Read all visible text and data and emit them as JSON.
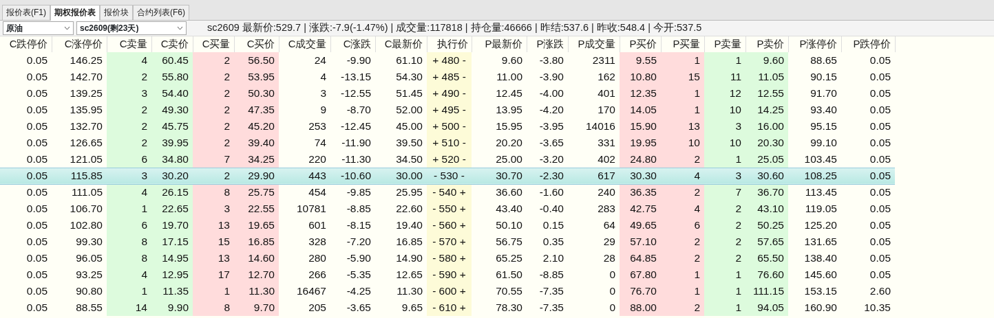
{
  "tabs": [
    {
      "label": "报价表(F1)",
      "selected": false
    },
    {
      "label": "期权报价表",
      "selected": true
    },
    {
      "label": "报价块",
      "selected": false
    },
    {
      "label": "合约列表(F6)",
      "selected": false
    }
  ],
  "selectors": [
    {
      "value": "原油"
    },
    {
      "value": "sc2609(剩23天)"
    }
  ],
  "info_line": "sc2609 最新价:529.7 | 涨跌:-7.9(-1.47%) | 成交量:117818 | 持仓量:46666 | 昨结:537.6 | 昨收:548.4 | 今开:537.5",
  "table": {
    "columns": [
      {
        "label": "C跌停价"
      },
      {
        "label": "C涨停价"
      },
      {
        "label": "C卖量",
        "color": "#ddfbdd"
      },
      {
        "label": "C卖价",
        "color": "#ddfbdd"
      },
      {
        "label": "C买量",
        "color": "#ffdcdc"
      },
      {
        "label": "C买价",
        "color": "#ffdcdc"
      },
      {
        "label": "C成交量"
      },
      {
        "label": "C涨跌"
      },
      {
        "label": "C最新价"
      },
      {
        "label": "执行价",
        "color": "#fdfbd8"
      },
      {
        "label": "P最新价"
      },
      {
        "label": "P涨跌"
      },
      {
        "label": "P成交量"
      },
      {
        "label": "P买价",
        "color": "#ffdcdc"
      },
      {
        "label": "P买量",
        "color": "#ffdcdc"
      },
      {
        "label": "P卖量",
        "color": "#ddfbdd"
      },
      {
        "label": "P卖价",
        "color": "#ddfbdd"
      },
      {
        "label": "P涨停价"
      },
      {
        "label": "P跌停价"
      }
    ],
    "rows": [
      {
        "selected": false,
        "cells": [
          "0.05",
          "146.25",
          "4",
          "60.45",
          "2",
          "56.50",
          "24",
          "-9.90",
          "61.10",
          "+ 480 -",
          "9.60",
          "-3.80",
          "2311",
          "9.55",
          "1",
          "1",
          "9.60",
          "88.65",
          "0.05"
        ]
      },
      {
        "selected": false,
        "cells": [
          "0.05",
          "142.70",
          "2",
          "55.80",
          "2",
          "53.95",
          "4",
          "-13.15",
          "54.30",
          "+ 485 -",
          "11.00",
          "-3.90",
          "162",
          "10.80",
          "15",
          "11",
          "11.05",
          "90.15",
          "0.05"
        ]
      },
      {
        "selected": false,
        "cells": [
          "0.05",
          "139.25",
          "3",
          "54.40",
          "2",
          "50.30",
          "3",
          "-12.55",
          "51.45",
          "+ 490 -",
          "12.45",
          "-4.00",
          "401",
          "12.35",
          "1",
          "12",
          "12.55",
          "91.70",
          "0.05"
        ]
      },
      {
        "selected": false,
        "cells": [
          "0.05",
          "135.95",
          "2",
          "49.30",
          "2",
          "47.35",
          "9",
          "-8.70",
          "52.00",
          "+ 495 -",
          "13.95",
          "-4.20",
          "170",
          "14.05",
          "1",
          "10",
          "14.25",
          "93.40",
          "0.05"
        ]
      },
      {
        "selected": false,
        "cells": [
          "0.05",
          "132.70",
          "2",
          "45.75",
          "2",
          "45.20",
          "253",
          "-12.45",
          "45.00",
          "+ 500 -",
          "15.95",
          "-3.95",
          "14016",
          "15.90",
          "13",
          "3",
          "16.00",
          "95.15",
          "0.05"
        ]
      },
      {
        "selected": false,
        "cells": [
          "0.05",
          "126.65",
          "2",
          "39.95",
          "2",
          "39.40",
          "74",
          "-11.90",
          "39.50",
          "+ 510 -",
          "20.20",
          "-3.65",
          "331",
          "19.95",
          "10",
          "10",
          "20.30",
          "99.10",
          "0.05"
        ]
      },
      {
        "selected": false,
        "cells": [
          "0.05",
          "121.05",
          "6",
          "34.80",
          "7",
          "34.25",
          "220",
          "-11.30",
          "34.50",
          "+ 520 -",
          "25.00",
          "-3.20",
          "402",
          "24.80",
          "2",
          "1",
          "25.05",
          "103.45",
          "0.05"
        ]
      },
      {
        "selected": true,
        "cells": [
          "0.05",
          "115.85",
          "3",
          "30.20",
          "2",
          "29.90",
          "443",
          "-10.60",
          "30.00",
          "- 530 -",
          "30.70",
          "-2.30",
          "617",
          "30.30",
          "4",
          "3",
          "30.60",
          "108.25",
          "0.05"
        ]
      },
      {
        "selected": false,
        "cells": [
          "0.05",
          "111.05",
          "4",
          "26.15",
          "8",
          "25.75",
          "454",
          "-9.85",
          "25.95",
          "- 540 +",
          "36.60",
          "-1.60",
          "240",
          "36.35",
          "2",
          "7",
          "36.70",
          "113.45",
          "0.05"
        ]
      },
      {
        "selected": false,
        "cells": [
          "0.05",
          "106.70",
          "1",
          "22.65",
          "3",
          "22.55",
          "10781",
          "-8.85",
          "22.60",
          "- 550 +",
          "43.40",
          "-0.40",
          "283",
          "42.75",
          "4",
          "2",
          "43.10",
          "119.05",
          "0.05"
        ]
      },
      {
        "selected": false,
        "cells": [
          "0.05",
          "102.80",
          "6",
          "19.70",
          "13",
          "19.65",
          "601",
          "-8.15",
          "19.40",
          "- 560 +",
          "50.10",
          "0.15",
          "64",
          "49.65",
          "6",
          "2",
          "50.25",
          "125.20",
          "0.05"
        ]
      },
      {
        "selected": false,
        "cells": [
          "0.05",
          "99.30",
          "8",
          "17.15",
          "15",
          "16.85",
          "328",
          "-7.20",
          "16.85",
          "- 570 +",
          "56.75",
          "0.35",
          "29",
          "57.10",
          "2",
          "2",
          "57.65",
          "131.65",
          "0.05"
        ]
      },
      {
        "selected": false,
        "cells": [
          "0.05",
          "96.05",
          "8",
          "14.95",
          "13",
          "14.60",
          "280",
          "-5.90",
          "14.90",
          "- 580 +",
          "65.25",
          "2.10",
          "28",
          "64.85",
          "2",
          "2",
          "65.50",
          "138.40",
          "0.05"
        ]
      },
      {
        "selected": false,
        "cells": [
          "0.05",
          "93.25",
          "4",
          "12.95",
          "17",
          "12.70",
          "266",
          "-5.35",
          "12.65",
          "- 590 +",
          "61.50",
          "-8.85",
          "0",
          "67.80",
          "1",
          "1",
          "76.60",
          "145.60",
          "0.05"
        ]
      },
      {
        "selected": false,
        "cells": [
          "0.05",
          "90.80",
          "1",
          "11.35",
          "1",
          "11.30",
          "16467",
          "-4.25",
          "11.30",
          "- 600 +",
          "70.55",
          "-7.35",
          "0",
          "76.70",
          "1",
          "1",
          "111.15",
          "153.15",
          "2.60"
        ]
      },
      {
        "selected": false,
        "cells": [
          "0.05",
          "88.55",
          "14",
          "9.90",
          "8",
          "9.70",
          "205",
          "-3.65",
          "9.65",
          "- 610 +",
          "78.30",
          "-7.35",
          "0",
          "88.00",
          "2",
          "1",
          "94.05",
          "160.90",
          "10.35"
        ]
      }
    ]
  }
}
